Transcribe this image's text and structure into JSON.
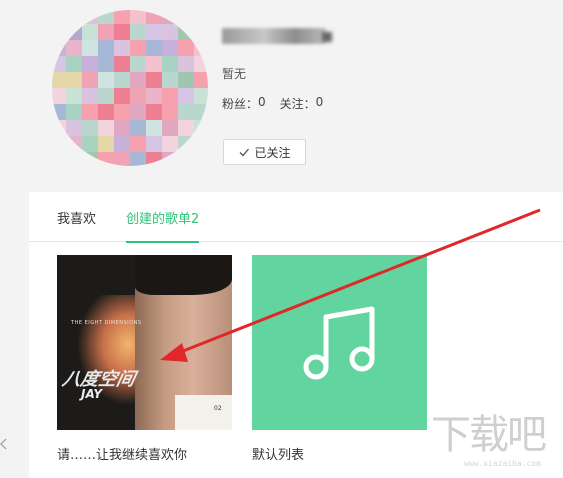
{
  "profile": {
    "bio": "暂无",
    "fans_label": "粉丝：",
    "fans_count": "0",
    "following_label": "关注：",
    "following_count": "0",
    "follow_button_label": "已关注"
  },
  "tabs": [
    {
      "label": "我喜欢",
      "active": false
    },
    {
      "label": "创建的歌单2",
      "active": true
    }
  ],
  "playlists": [
    {
      "title": "请……让我继续喜欢你",
      "cover": "album-art",
      "cover_text": {
        "small": "THE EIGHT DIMENSIONS",
        "logo": "八度空间",
        "logo2": "JAY",
        "num": "02"
      }
    },
    {
      "title": "默认列表",
      "cover": "music-note-icon"
    }
  ],
  "watermark": {
    "text": "下载吧",
    "url": "www.xiazaiba.com"
  },
  "colors": {
    "accent": "#31c27c",
    "default_cover": "#62d49f",
    "arrow": "#e0282a"
  }
}
